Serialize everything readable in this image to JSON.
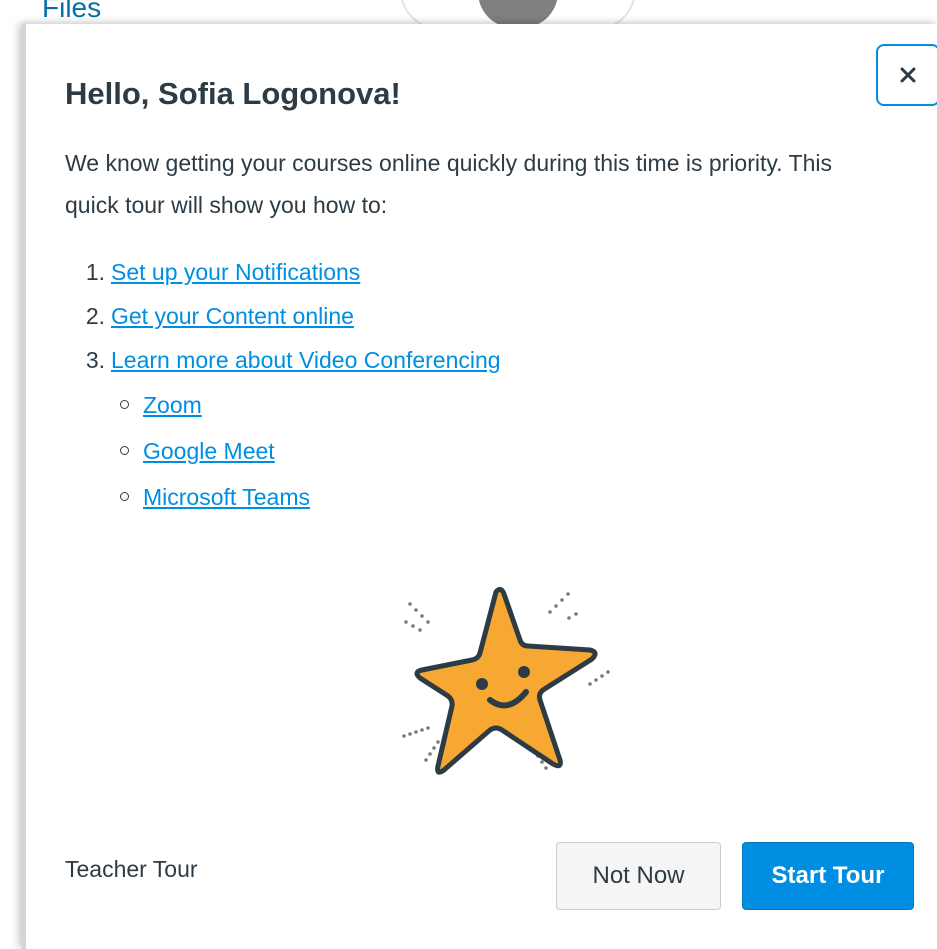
{
  "background": {
    "link_label": "Files"
  },
  "dialog": {
    "title": "Hello, Sofia Logonova!",
    "intro": "We know getting your courses online quickly during this time is priority. This quick tour will show you how to:",
    "steps": [
      {
        "number": "1.",
        "label": "Set up your Notifications"
      },
      {
        "number": "2.",
        "label": "Get your Content online"
      },
      {
        "number": "3.",
        "label": "Learn more about Video Conferencing"
      }
    ],
    "video_options": [
      {
        "label": "Zoom"
      },
      {
        "label": "Google Meet"
      },
      {
        "label": "Microsoft Teams"
      }
    ],
    "illustration_icon": "smiling-star-icon",
    "close_icon": "close-icon",
    "footer_label": "Teacher Tour",
    "buttons": {
      "not_now": "Not Now",
      "start_tour": "Start Tour"
    }
  },
  "colors": {
    "link": "#008ee2",
    "primary_button": "#008ee2",
    "text": "#2d3b45",
    "star_fill": "#f7a832",
    "star_stroke": "#2d3b45"
  }
}
